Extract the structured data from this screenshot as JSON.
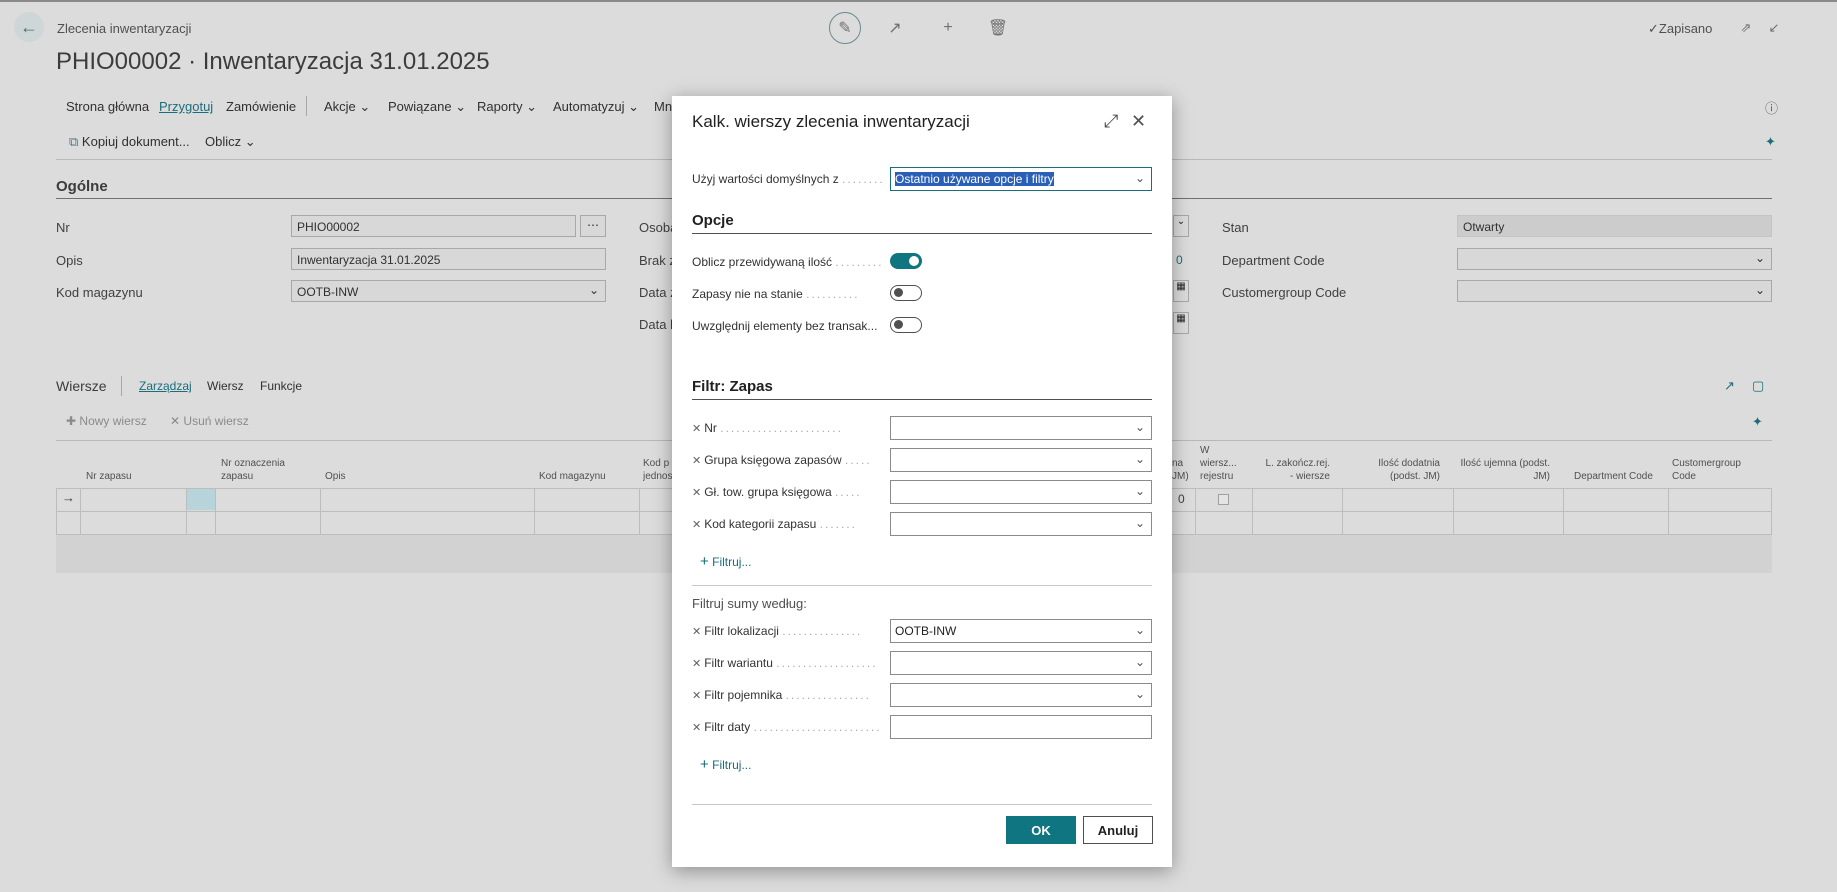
{
  "app": {
    "breadcrumb": "Zlecenia inwentaryzacji",
    "title": "PHIO00002 · Inwentaryzacja 31.01.2025",
    "saved": "Zapisano"
  },
  "menu": {
    "items": [
      "Strona główna",
      "Przygotuj",
      "Zamówienie",
      "Akcje",
      "Powiązane",
      "Raporty",
      "Automatyzuj",
      "Mn"
    ],
    "sub": [
      "Kopiuj dokument...",
      "Oblicz"
    ]
  },
  "general": {
    "header": "Ogólne",
    "nr_label": "Nr",
    "nr_value": "PHIO00002",
    "opis_label": "Opis",
    "opis_value": "Inwentaryzacja 31.01.2025",
    "kod_label": "Kod magazynu",
    "kod_value": "OOTB-INW",
    "mid_labels": [
      "Osoba",
      "Brak z",
      "Data z",
      "Data k"
    ],
    "mid_value": "0",
    "stan_label": "Stan",
    "stan_value": "Otwarty",
    "dept_label": "Department Code",
    "cust_label": "Customergroup Code"
  },
  "lines": {
    "header": "Wiersze",
    "tabs": [
      "Zarządzaj",
      "Wiersz",
      "Funkcje"
    ],
    "actions": [
      "Nowy wiersz",
      "Usuń wiersz"
    ],
    "columns": [
      "Nr zapasu",
      "Nr oznaczenia zapasu",
      "Opis",
      "Kod magazynu",
      "Kod p jednos",
      "na JM)",
      "W wiersz... rejestru",
      "L. zakończ.rej. - wiersze",
      "Ilość dodatnia (podst. JM)",
      "Ilość ujemna (podst. JM)",
      "Department Code",
      "Customergroup Code"
    ],
    "row_value": "0"
  },
  "dialog": {
    "title": "Kalk. wierszy zlecenia inwentaryzacji",
    "defaults_label": "Użyj wartości domyślnych z",
    "defaults_value": "Ostatnio używane opcje i filtry",
    "options_header": "Opcje",
    "options": [
      {
        "label": "Oblicz przewidywaną ilość",
        "on": true
      },
      {
        "label": "Zapasy nie na stanie",
        "on": false
      },
      {
        "label": "Uwzględnij elementy bez transak...",
        "on": false
      }
    ],
    "filter_header": "Filtr: Zapas",
    "filters": [
      {
        "label": "Nr",
        "value": ""
      },
      {
        "label": "Grupa księgowa zapasów",
        "value": ""
      },
      {
        "label": "Gł. tow. grupa księgowa",
        "value": ""
      },
      {
        "label": "Kod kategorii zapasu",
        "value": ""
      }
    ],
    "add_filter": "Filtruj...",
    "totals_header": "Filtruj sumy według:",
    "totals": [
      {
        "label": "Filtr lokalizacji",
        "value": "OOTB-INW"
      },
      {
        "label": "Filtr wariantu",
        "value": ""
      },
      {
        "label": "Filtr pojemnika",
        "value": ""
      },
      {
        "label": "Filtr daty",
        "value": ""
      }
    ],
    "ok": "OK",
    "cancel": "Anuluj"
  }
}
